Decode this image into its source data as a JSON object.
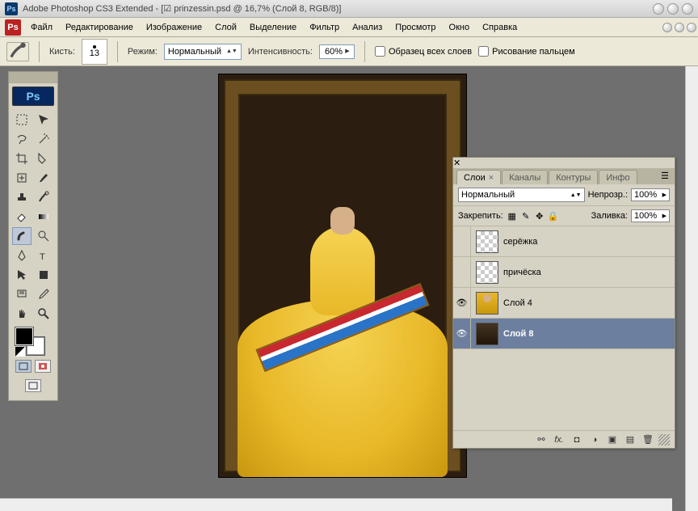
{
  "title": "Adobe Photoshop CS3 Extended - [☑ prinzessin.psd @ 16,7% (Слой 8, RGB/8)]",
  "menu": [
    "Файл",
    "Редактирование",
    "Изображение",
    "Слой",
    "Выделение",
    "Фильтр",
    "Анализ",
    "Просмотр",
    "Окно",
    "Справка"
  ],
  "options": {
    "brush_label": "Кисть:",
    "brush_size": "13",
    "mode_label": "Режим:",
    "mode_value": "Нормальный",
    "strength_label": "Интенсивность:",
    "strength_value": "60%",
    "sample_all": "Образец всех слоев",
    "finger_paint": "Рисование пальцем"
  },
  "toolbox": {
    "badge": "Ps"
  },
  "panel": {
    "tabs": {
      "layers": "Слои",
      "channels": "Каналы",
      "paths": "Контуры",
      "info": "Инфо"
    },
    "blend_mode": "Нормальный",
    "opacity_label": "Непрозр.:",
    "opacity_value": "100%",
    "lock_label": "Закрепить:",
    "fill_label": "Заливка:",
    "fill_value": "100%",
    "layers": [
      {
        "name": "серёжка",
        "visible": false,
        "thumb": "checker"
      },
      {
        "name": "причёска",
        "visible": false,
        "thumb": "checker"
      },
      {
        "name": "Слой 4",
        "visible": true,
        "thumb": "img4"
      },
      {
        "name": "Слой 8",
        "visible": true,
        "thumb": "img8",
        "selected": true
      }
    ]
  }
}
